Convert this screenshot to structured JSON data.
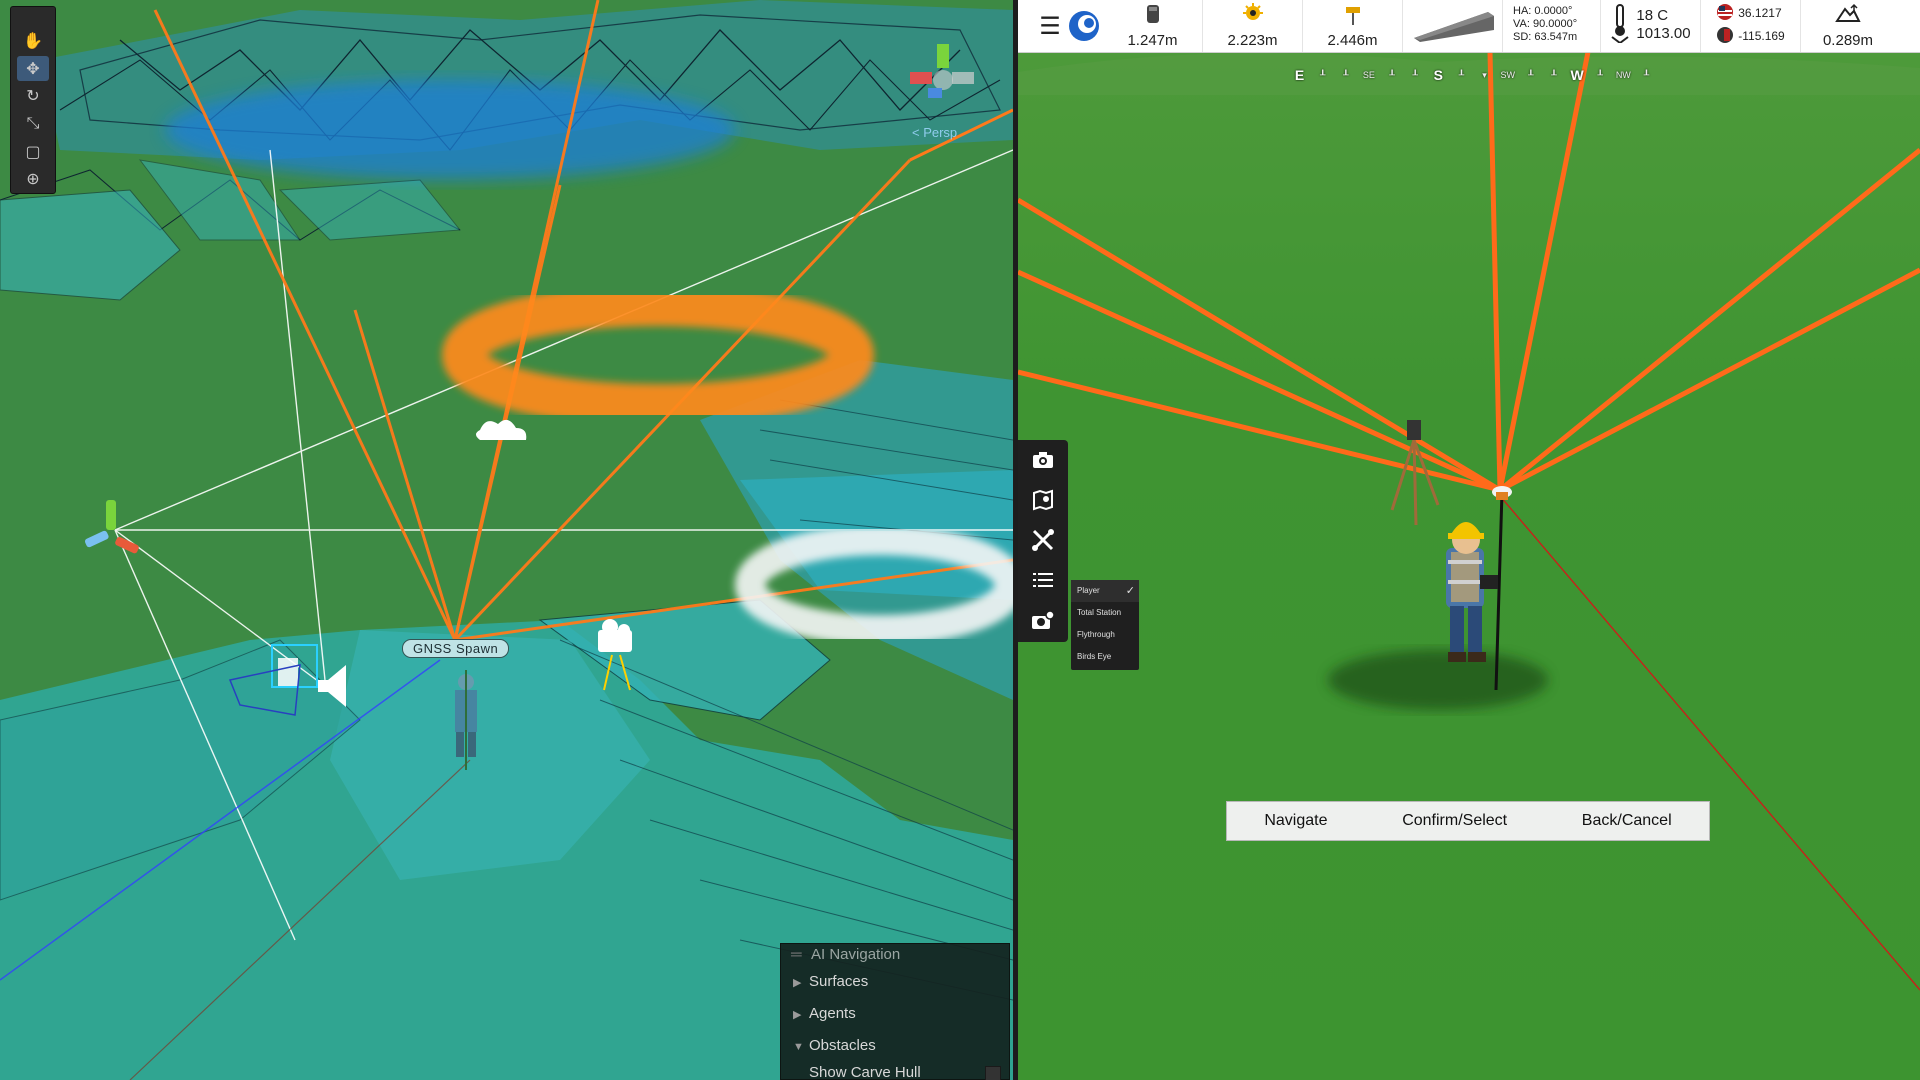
{
  "scene": {
    "gnss_label": "GNSS Spawn",
    "persp_label": "< Persp",
    "tools": [
      "hand-tool",
      "move-tool",
      "rotate-tool",
      "scale-tool",
      "rect-tool",
      "transform-tool"
    ],
    "ai_panel": {
      "title": "AI Navigation",
      "items": [
        {
          "label": "Surfaces",
          "expanded": false
        },
        {
          "label": "Agents",
          "expanded": false
        },
        {
          "label": "Obstacles",
          "expanded": true
        }
      ],
      "sub_item": "Show Carve Hull"
    }
  },
  "hud": {
    "values": {
      "h1": "1.247m",
      "h2": "2.223m",
      "h3": "2.446m",
      "ha": "HA: 0.0000°",
      "va": "VA: 90.0000°",
      "sd": "SD: 63.547m",
      "temp": "18",
      "temp_unit": "C",
      "pressure": "1013.00",
      "lat": "36.1217",
      "lon": "-115.169",
      "elev": "0.289m"
    },
    "icons": [
      "menu-icon",
      "logo-icon",
      "receiver-icon",
      "sun-target-icon",
      "prism-icon",
      "slope-icon",
      "angles-icon",
      "thermometer-icon",
      "flag-us-icon",
      "flag-globe-icon",
      "elevation-icon"
    ]
  },
  "compass": {
    "labels": [
      "E",
      "S",
      "W"
    ],
    "ticks": [
      "SE",
      "SW",
      "NW"
    ]
  },
  "camera_menu": {
    "options": [
      {
        "label": "Player",
        "selected": true
      },
      {
        "label": "Total Station",
        "selected": false
      },
      {
        "label": "Flythrough",
        "selected": false
      },
      {
        "label": "Birds Eye",
        "selected": false
      }
    ]
  },
  "controls": {
    "navigate": "Navigate",
    "confirm": "Confirm/Select",
    "back": "Back/Cancel"
  },
  "colors": {
    "accent_orange": "#ff7a1a",
    "ground_green": "#3e9431",
    "navmesh_cyan": "#36b6c4"
  }
}
